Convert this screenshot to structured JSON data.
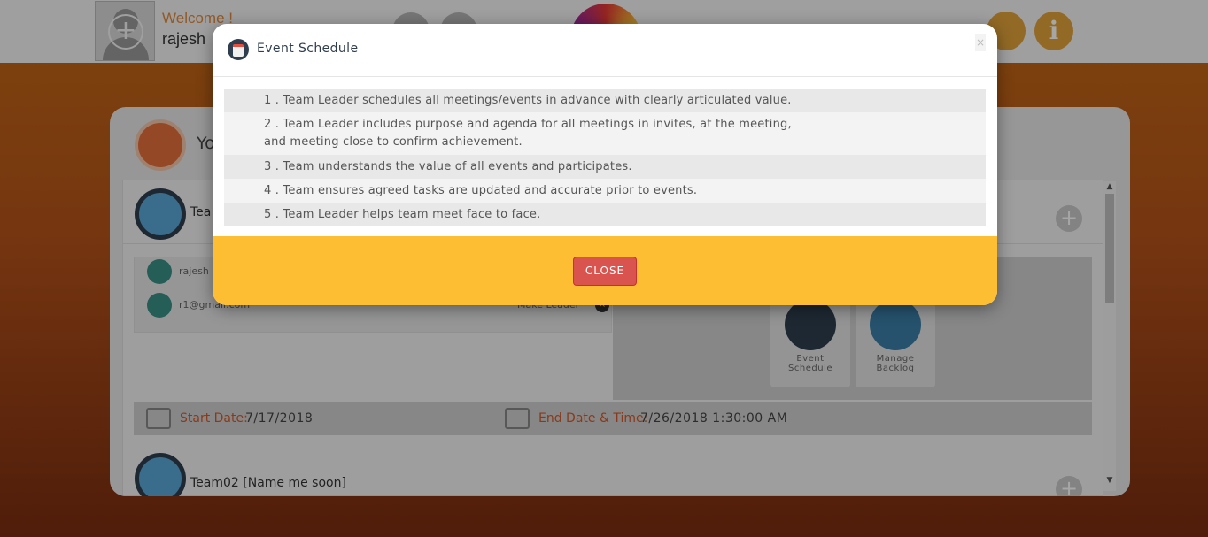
{
  "header": {
    "welcome": "Welcome !",
    "username": "rajesh"
  },
  "card": {
    "title": "Yo",
    "teams": [
      {
        "name": "Tea"
      },
      {
        "name": "Team02 [Name me soon]"
      }
    ],
    "members": [
      {
        "email": "rajesh",
        "action": ""
      },
      {
        "email": "r1@gmail.com",
        "action": "Make Leader"
      }
    ],
    "tiles": [
      {
        "label_line1": "Event",
        "label_line2": "Schedule"
      },
      {
        "label_line1": "Manage",
        "label_line2": "Backlog"
      }
    ],
    "start_date_label": "Start Date:",
    "start_date_value": "7/17/2018",
    "end_date_label": "End Date & Time:",
    "end_date_value": "7/26/2018 1:30:00 AM"
  },
  "modal": {
    "title": "Event Schedule",
    "close_x": "×",
    "items": [
      "1 . Team Leader schedules all meetings/events in advance with clearly articulated value.",
      "2 . Team Leader includes purpose and agenda for all meetings in invites, at the meeting,",
      "and meeting close to confirm achievement.",
      "3 . Team understands the value of all events and participates.",
      "4 . Team ensures agreed tasks are updated and accurate prior to events.",
      "5 . Team Leader helps team meet face to face."
    ],
    "close_label": "CLOSE"
  },
  "colors": {
    "accent_orange": "#e08a3c",
    "footer_yellow": "#fdbe34",
    "close_red": "#d9534f",
    "date_label": "#d35a2a"
  }
}
